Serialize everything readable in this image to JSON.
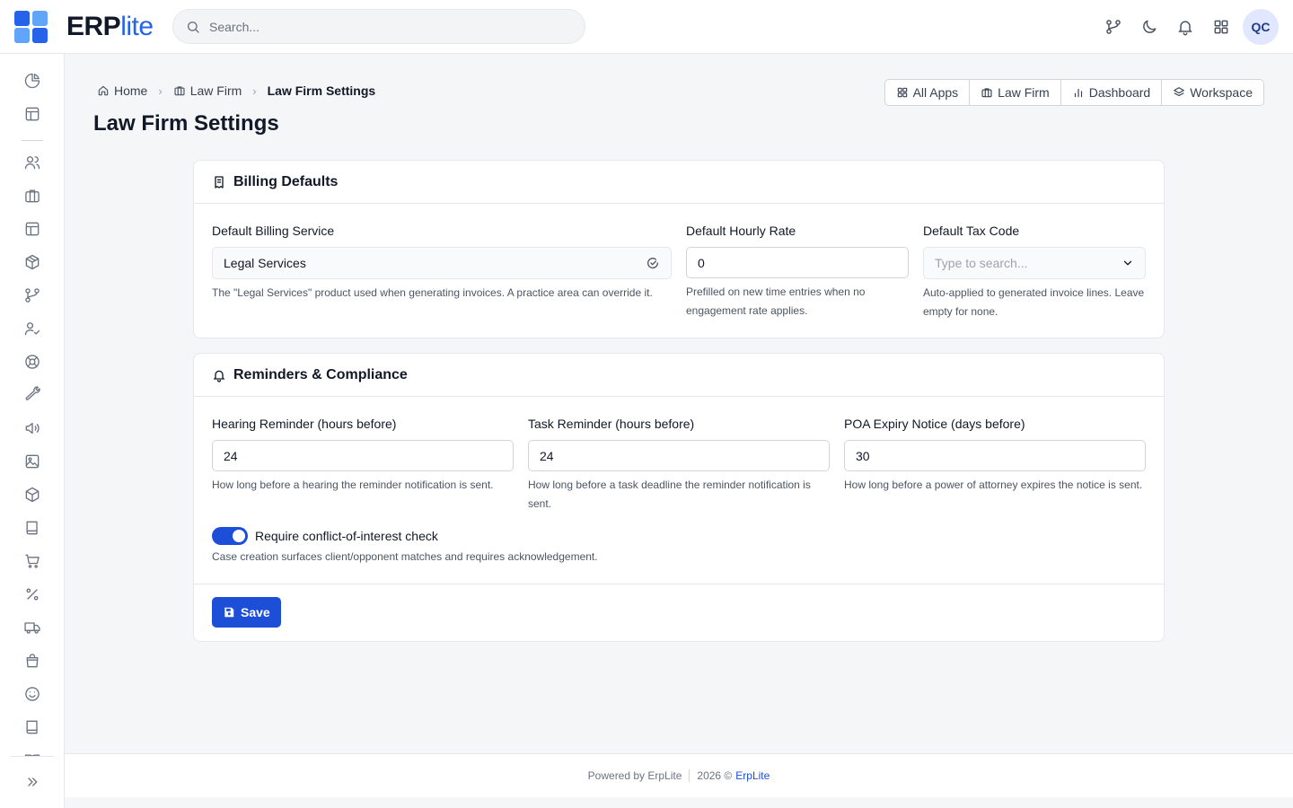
{
  "app": {
    "logo_main": "ERP",
    "logo_accent": "lite",
    "brand_color": "#2563eb"
  },
  "search": {
    "placeholder": "Search..."
  },
  "header": {
    "avatar_initials": "QC"
  },
  "breadcrumb": [
    {
      "label": "Home",
      "icon": "home-icon"
    },
    {
      "label": "Law Firm",
      "icon": "briefcase-icon"
    },
    {
      "label": "Law Firm Settings"
    }
  ],
  "breadcrumb_separator": "›",
  "page": {
    "title": "Law Firm Settings"
  },
  "app_links": [
    {
      "label": "All Apps",
      "icon": "grid-icon"
    },
    {
      "label": "Law Firm",
      "icon": "briefcase-icon"
    },
    {
      "label": "Dashboard",
      "icon": "bar-chart-icon"
    },
    {
      "label": "Workspace",
      "icon": "layers-icon"
    }
  ],
  "billing": {
    "title": "Billing Defaults",
    "service": {
      "label": "Default Billing Service",
      "value": "Legal Services",
      "hint": "The \"Legal Services\" product used when generating invoices. A practice area can override it."
    },
    "rate": {
      "label": "Default Hourly Rate",
      "value": "0",
      "hint": "Prefilled on new time entries when no engagement rate applies."
    },
    "tax": {
      "label": "Default Tax Code",
      "placeholder": "Type to search...",
      "hint": "Auto-applied to generated invoice lines. Leave empty for none."
    }
  },
  "reminders": {
    "title": "Reminders & Compliance",
    "hearing": {
      "label": "Hearing Reminder (hours before)",
      "value": "24",
      "hint": "How long before a hearing the reminder notification is sent."
    },
    "task": {
      "label": "Task Reminder (hours before)",
      "value": "24",
      "hint": "How long before a task deadline the reminder notification is sent."
    },
    "poa": {
      "label": "POA Expiry Notice (days before)",
      "value": "30",
      "hint": "How long before a power of attorney expires the notice is sent."
    },
    "conflict": {
      "label": "Require conflict-of-interest check",
      "enabled": true,
      "hint": "Case creation surfaces client/opponent matches and requires acknowledgement."
    },
    "save_label": "Save"
  },
  "footer": {
    "powered": "Powered by ErpLite",
    "copyright": "2026 ©",
    "brand": "ErpLite"
  }
}
